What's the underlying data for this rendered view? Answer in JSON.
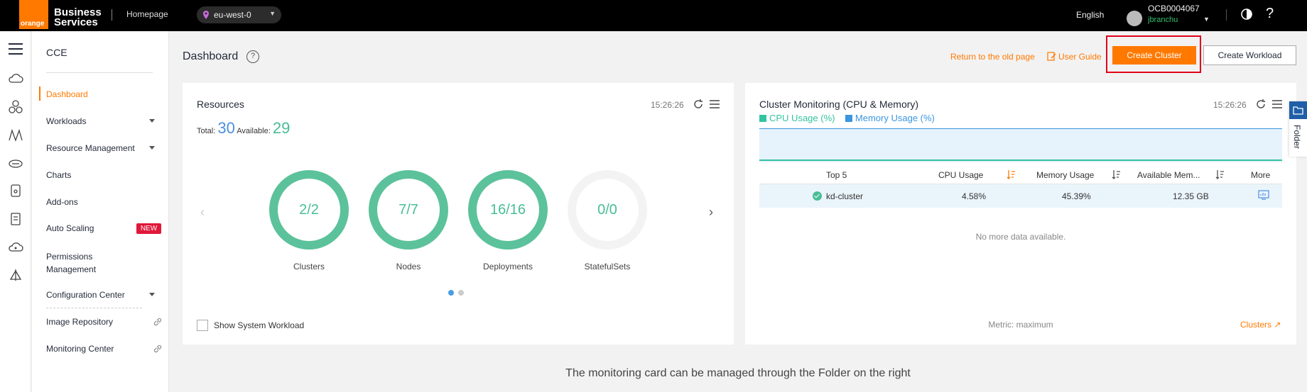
{
  "topbar": {
    "logo_text": "orange",
    "brand_line1": "Business",
    "brand_line2": "Services",
    "homepage": "Homepage",
    "region": "eu-west-0",
    "language": "English",
    "account": "OCB0004067",
    "user": "jbranchu",
    "help": "?"
  },
  "sidemenu": {
    "title": "CCE",
    "items": [
      {
        "label": "Dashboard"
      },
      {
        "label": "Workloads"
      },
      {
        "label": "Resource Management"
      },
      {
        "label": "Charts"
      },
      {
        "label": "Add-ons"
      },
      {
        "label": "Auto Scaling"
      },
      {
        "label": "Permissions Management"
      },
      {
        "label": "Configuration Center"
      },
      {
        "label": "Image Repository"
      },
      {
        "label": "Monitoring Center"
      }
    ],
    "new_badge": "NEW"
  },
  "header": {
    "title": "Dashboard",
    "help": "?",
    "old_page": "Return to the old page",
    "user_guide": "User Guide",
    "create_cluster": "Create Cluster",
    "create_workload": "Create Workload"
  },
  "resources": {
    "title": "Resources",
    "time": "15:26:26",
    "total_label": "Total:",
    "total": "30",
    "available_label": "Available:",
    "available": "29",
    "rings": [
      {
        "value": "2/2",
        "label": "Clusters"
      },
      {
        "value": "7/7",
        "label": "Nodes"
      },
      {
        "value": "16/16",
        "label": "Deployments"
      },
      {
        "value": "0/0",
        "label": "StatefulSets"
      }
    ],
    "prev": "‹",
    "next": "›",
    "show_system": "Show System Workload"
  },
  "monitoring": {
    "title": "Cluster Monitoring (CPU & Memory)",
    "time": "15:26:26",
    "legend_cpu": "CPU Usage (%)",
    "legend_mem": "Memory Usage (%)",
    "columns": {
      "top": "Top 5",
      "cpu": "CPU Usage",
      "mem": "Memory Usage",
      "avail": "Available Mem...",
      "more": "More"
    },
    "rows": [
      {
        "name": "kd-cluster",
        "cpu": "4.58%",
        "mem": "45.39%",
        "avail": "12.35 GB"
      }
    ],
    "no_more": "No more data available.",
    "metric": "Metric: maximum",
    "clusters_link": "Clusters ↗"
  },
  "folder": {
    "label": "Folder"
  },
  "footer": {
    "message": "The monitoring card can be managed through the Folder on the right"
  },
  "colors": {
    "accent": "#ff7900",
    "ring": "#5cc29b",
    "cpu": "#34c3a0",
    "memory": "#3a96e0",
    "highlight": "#e0001a"
  }
}
